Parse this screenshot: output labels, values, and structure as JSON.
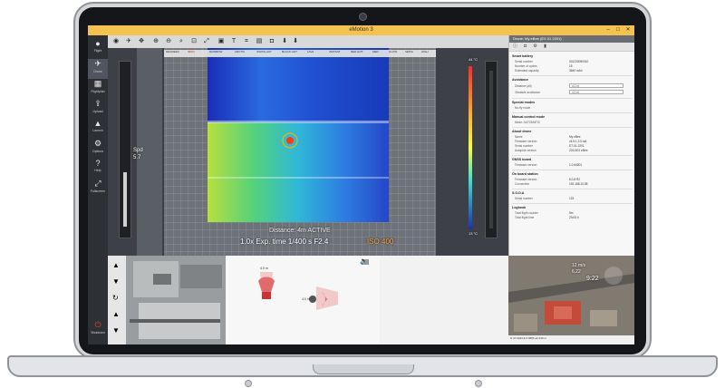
{
  "window": {
    "title": "eMotion 3"
  },
  "toolbar": {
    "icons": [
      "eye-icon",
      "drone-icon",
      "pan-icon",
      "zoom-in-icon",
      "zoom-out-icon",
      "search-icon",
      "fit-icon",
      "expand-icon",
      "image-icon",
      "text-icon",
      "crop-icon",
      "layers-icon",
      "camera-icon",
      "marker-icon",
      "marker-icon"
    ]
  },
  "sidebar": {
    "items": [
      {
        "label": "Flight",
        "icon": "flight-icon"
      },
      {
        "label": "Drone",
        "icon": "drone-icon"
      },
      {
        "label": "Flightplan",
        "icon": "flightplan-icon"
      },
      {
        "label": "Upload",
        "icon": "upload-icon"
      },
      {
        "label": "Launch",
        "icon": "launch-icon"
      },
      {
        "label": "Options",
        "icon": "options-icon"
      },
      {
        "label": "Help",
        "icon": "help-icon"
      },
      {
        "label": "Fullscreen",
        "icon": "fullscreen-icon"
      }
    ],
    "footer_label": "Shutdown"
  },
  "camera": {
    "gimbal_label": "Spd",
    "gimbal_value": "5.7",
    "status": "Distance: 4m  ACTIVE",
    "exposure_line": "1.0x  Exp. time 1/400 s  F2.4",
    "iso": "ISO 400",
    "palette": [
      "DEGREES",
      "IRON",
      "RAINBOW",
      "ARCTIC",
      "WHITE HOT",
      "BLACK HOT",
      "LAVA",
      "INSTANT",
      "RED HOT",
      "MED",
      "GLOW",
      "SEPIA",
      "HIGH"
    ],
    "scale_top": "44 °C",
    "scale_bottom": "13 °C"
  },
  "proximity": {
    "front_distance": "4.0 m",
    "side_distance": "4.0 m"
  },
  "panel": {
    "header": "Drone: My eBee (EX 01 2201)",
    "sections": [
      {
        "title": "Smart battery",
        "rows": [
          [
            "Serial number",
            "001230090010"
          ],
          [
            "Number of cycles",
            "15"
          ],
          [
            "Estimated capacity",
            "3640 mAh"
          ]
        ]
      },
      {
        "title": "Avoidance",
        "rows": [
          [
            "Distance (all)",
            "4.0 m"
          ],
          [
            "Obstacle avoidance",
            "4.0 m"
          ]
        ]
      },
      {
        "title": "Special modes",
        "rows": [
          [
            "No-fly mode",
            ""
          ]
        ]
      },
      {
        "title": "Manual control mode",
        "rows": [
          [
            "Mode: AUTOMATIC",
            ""
          ]
        ]
      },
      {
        "title": "About drone",
        "rows": [
          [
            "Name",
            "My eBee"
          ],
          [
            "Firmware version",
            "v4.5.1.2.0.rc6"
          ],
          [
            "Serial number",
            "ET-01-2201"
          ],
          [
            "Autopilot version",
            "2011001 eBee"
          ]
        ]
      },
      {
        "title": "GNSS board",
        "rows": [
          [
            "Firmware version",
            "1.0.64001"
          ]
        ]
      },
      {
        "title": "On board station",
        "rows": [
          [
            "Firmware version",
            "6.0.8 R2"
          ],
          [
            "Connection",
            "192.168.10.58"
          ]
        ]
      },
      {
        "title": "S.O.D.A",
        "rows": [
          [
            "Serial number",
            "123"
          ]
        ]
      },
      {
        "title": "Logbook",
        "rows": [
          [
            "Total flight counter",
            "5m"
          ],
          [
            "Total flight time",
            "23:05 h"
          ]
        ]
      }
    ]
  },
  "map": {
    "overlay_line1": "12 m/s",
    "overlay_line2": "6.22",
    "time": "9:22",
    "footer": "N 47.0223  E 6.9856  alt 430 m"
  },
  "colors": {
    "accent": "#f3c24f",
    "panel_bg": "#f7f7f7",
    "dark_bg": "#2b2e33"
  }
}
